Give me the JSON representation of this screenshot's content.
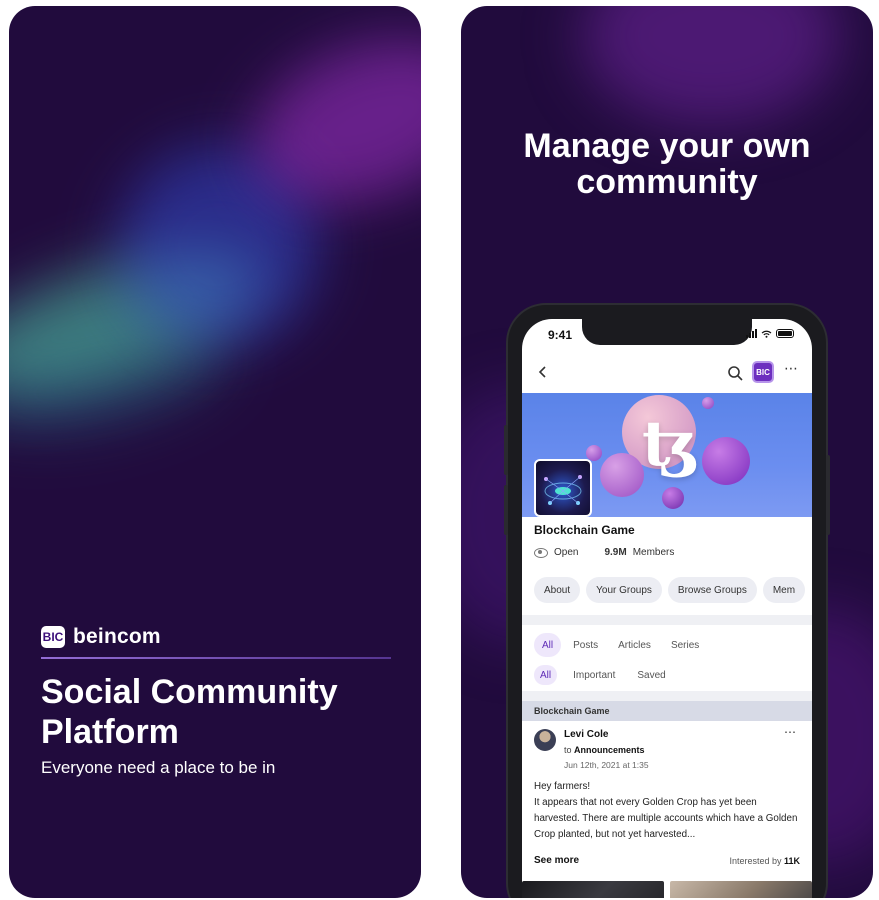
{
  "left": {
    "brand": {
      "logo_text": "BIC",
      "name": "beincom"
    },
    "headline": "Social Community Platform",
    "subline": "Everyone need a place to be in"
  },
  "right": {
    "headline": "Manage your own community",
    "phone": {
      "status_time": "9:41",
      "nav": {
        "logo_text": "BIC"
      },
      "group": {
        "name": "Blockchain Game",
        "privacy": "Open",
        "member_count": "9.9M",
        "member_label": "Members",
        "chips": [
          "About",
          "Your Groups",
          "Browse Groups",
          "Mem"
        ]
      },
      "tabs_primary": [
        "All",
        "Posts",
        "Articles",
        "Series"
      ],
      "tabs_secondary": [
        "All",
        "Important",
        "Saved"
      ],
      "post": {
        "group_label": "Blockchain Game",
        "author": "Levi Cole",
        "to_prefix": "to",
        "to_target": "Announcements",
        "date": "Jun 12th, 2021 at 1:35",
        "body_lines": [
          "Hey farmers!",
          "It appears that not every Golden Crop has yet been harvested. There are multiple accounts which have a Golden Crop planted, but not yet harvested..."
        ],
        "see_more": "See more",
        "interested_prefix": "Interested by",
        "interested_count": "11K"
      }
    }
  },
  "colors": {
    "panel_bg": "#210b3d",
    "accent": "#6d2fbf",
    "active_tab_bg": "#eee7fb"
  }
}
